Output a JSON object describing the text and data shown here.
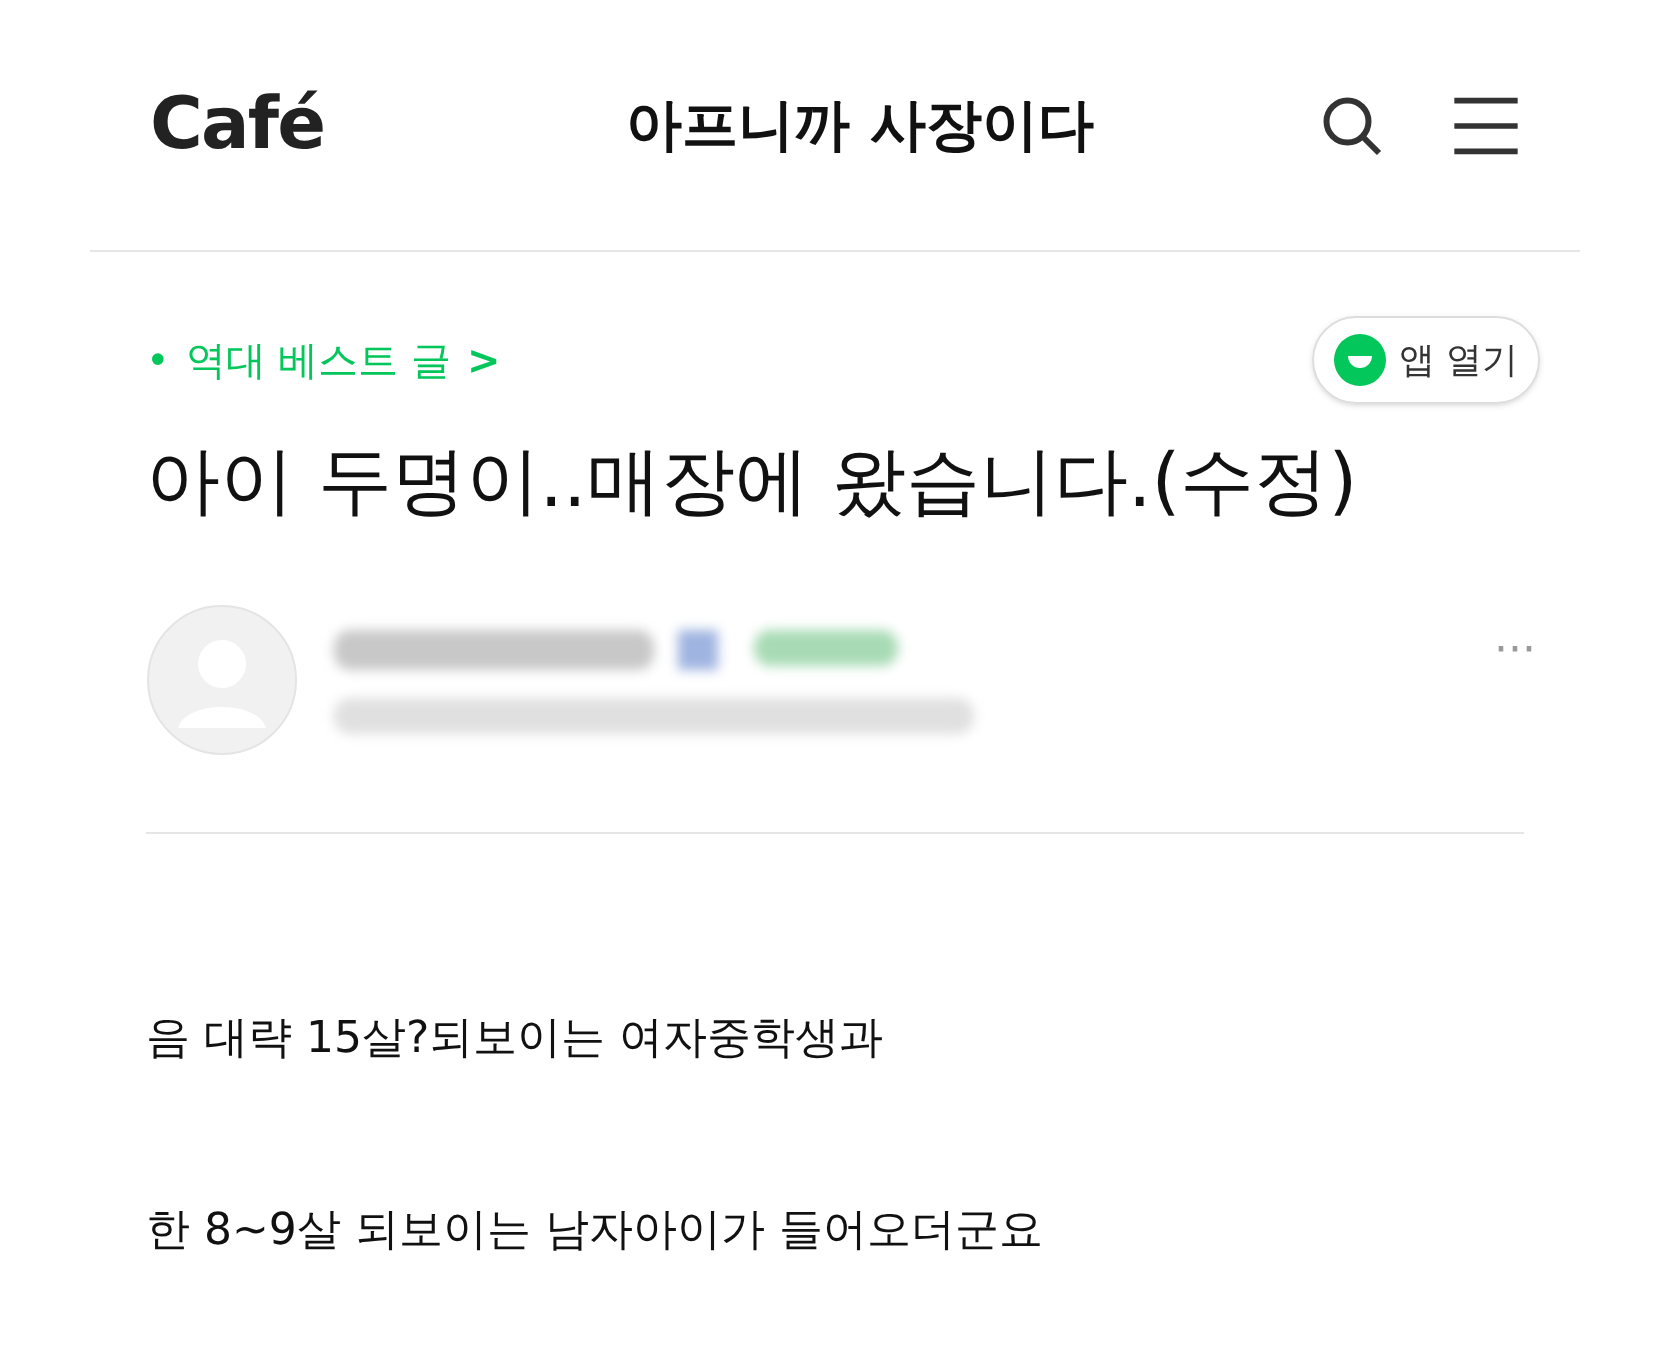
{
  "header": {
    "logo": "Café",
    "title": "아프니까 사장이다"
  },
  "breadcrumb": {
    "bullet": "•",
    "label": "역대 베스트 글",
    "chevron": ">"
  },
  "app_button": {
    "label": "앱 열기"
  },
  "post": {
    "title": "아이 두명이..매장에 왔습니다.(수정)",
    "more": "···",
    "paragraphs": [
      "음 대략 15살?되보이는 여자중학생과",
      "한 8~9살 되보이는 남자아이가 들어오더군요"
    ]
  }
}
